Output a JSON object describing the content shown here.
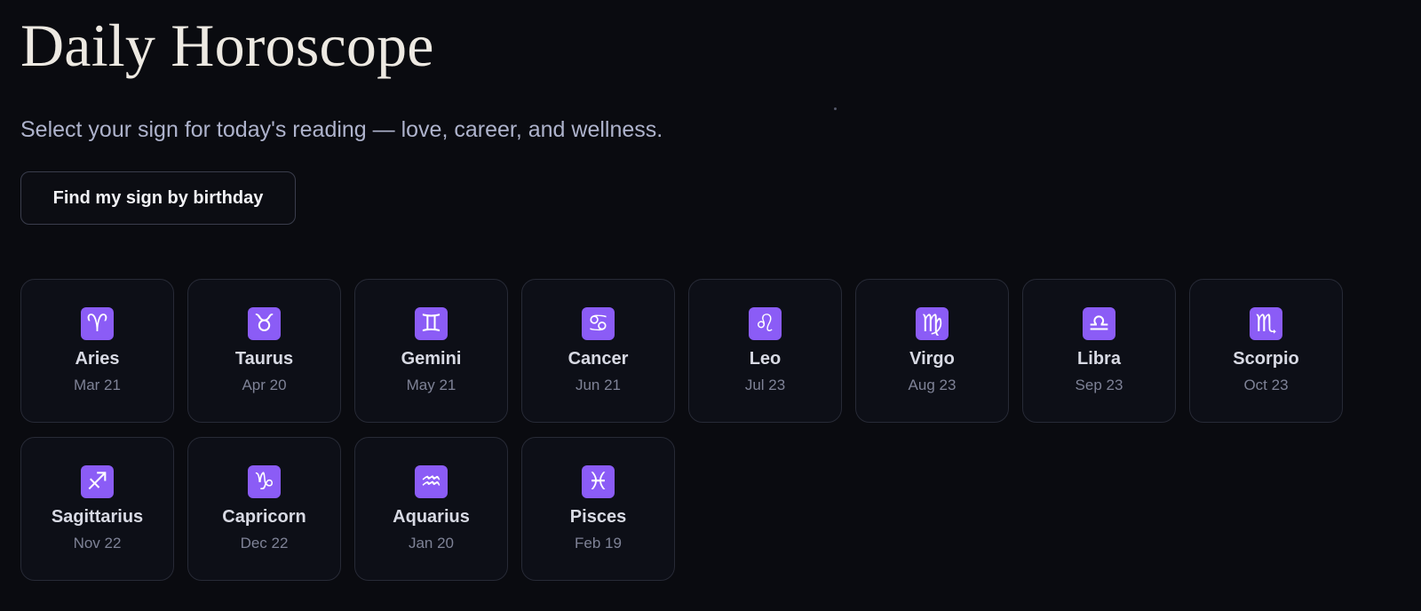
{
  "header": {
    "title": "Daily Horoscope",
    "subtitle": "Select your sign for today's reading — love, career, and wellness."
  },
  "actions": {
    "find_sign_label": "Find my sign by birthday"
  },
  "colors": {
    "background": "#0a0b10",
    "card_background": "#0d0f17",
    "card_border": "#272a36",
    "icon_accent": "#8b5cf6"
  },
  "signs": [
    {
      "name": "Aries",
      "date": "Mar 21",
      "symbol": "♈",
      "icon": "aries-icon"
    },
    {
      "name": "Taurus",
      "date": "Apr 20",
      "symbol": "♉",
      "icon": "taurus-icon"
    },
    {
      "name": "Gemini",
      "date": "May 21",
      "symbol": "♊",
      "icon": "gemini-icon"
    },
    {
      "name": "Cancer",
      "date": "Jun 21",
      "symbol": "♋",
      "icon": "cancer-icon"
    },
    {
      "name": "Leo",
      "date": "Jul 23",
      "symbol": "♌",
      "icon": "leo-icon"
    },
    {
      "name": "Virgo",
      "date": "Aug 23",
      "symbol": "♍",
      "icon": "virgo-icon"
    },
    {
      "name": "Libra",
      "date": "Sep 23",
      "symbol": "♎",
      "icon": "libra-icon"
    },
    {
      "name": "Scorpio",
      "date": "Oct 23",
      "symbol": "♏",
      "icon": "scorpio-icon"
    },
    {
      "name": "Sagittarius",
      "date": "Nov 22",
      "symbol": "♐",
      "icon": "sagittarius-icon"
    },
    {
      "name": "Capricorn",
      "date": "Dec 22",
      "symbol": "♑",
      "icon": "capricorn-icon"
    },
    {
      "name": "Aquarius",
      "date": "Jan 20",
      "symbol": "♒",
      "icon": "aquarius-icon"
    },
    {
      "name": "Pisces",
      "date": "Feb 19",
      "symbol": "♓",
      "icon": "pisces-icon"
    }
  ]
}
